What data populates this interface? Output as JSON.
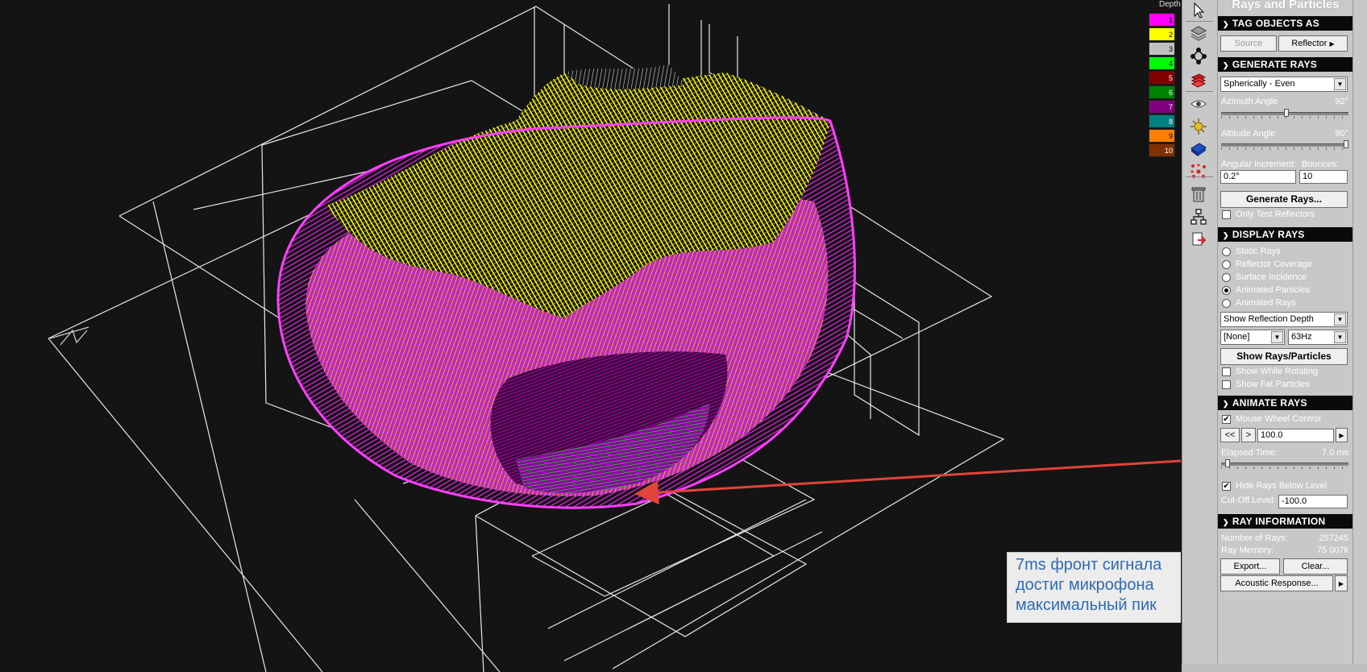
{
  "depth_legend": {
    "title": "Depth",
    "items": [
      {
        "label": "1",
        "color": "#ff00ff"
      },
      {
        "label": "2",
        "color": "#ffff00"
      },
      {
        "label": "3",
        "color": "#c0c0c0"
      },
      {
        "label": "4",
        "color": "#00ff00"
      },
      {
        "label": "5",
        "color": "#800000"
      },
      {
        "label": "6",
        "color": "#008000"
      },
      {
        "label": "7",
        "color": "#800080"
      },
      {
        "label": "8",
        "color": "#008080"
      },
      {
        "label": "9",
        "color": "#ff8000"
      },
      {
        "label": "10",
        "color": "#803000"
      }
    ]
  },
  "annotation": {
    "line1": "7ms фронт сигнала",
    "line2": "достиг микрофона",
    "line3": "максимальный пик"
  },
  "toolbar": {
    "tools": [
      "pointer-icon",
      "layers-icon",
      "nodes-icon",
      "materials-icon",
      "eye-icon",
      "light-icon",
      "surface-icon",
      "rays-icon",
      "trash-icon",
      "network-icon",
      "export-icon"
    ]
  },
  "panel": {
    "title": "Rays and Particles",
    "tag_objects": {
      "header": "TAG OBJECTS AS",
      "source_label": "Source",
      "reflector_label": "Reflector"
    },
    "generate_rays": {
      "header": "GENERATE RAYS",
      "distribution": "Spherically - Even",
      "azimuth_label": "Azimuth Angle",
      "azimuth_value": "92°",
      "azimuth_fraction": 0.51,
      "altitude_label": "Altitude Angle",
      "altitude_value": "90°",
      "altitude_fraction": 1.0,
      "increment_label": "Angular Increment:",
      "increment_value": "0.2°",
      "bounces_label": "Bounces:",
      "bounces_value": "10",
      "generate_button": "Generate Rays...",
      "only_test_label": "Only Test Reflectors"
    },
    "display_rays": {
      "header": "DISPLAY RAYS",
      "options": [
        "Static Rays",
        "Reflector Coverage",
        "Surface Incidence",
        "Animated Particles",
        "Animated Rays"
      ],
      "selected_option": "Animated Particles",
      "mode_select": "Show Reflection Depth",
      "filter_select": "[None]",
      "freq_select": "63Hz",
      "show_button": "Show Rays/Particles",
      "show_rotating_label": "Show While Rotating",
      "show_fat_label": "Show Fat Particles"
    },
    "animate_rays": {
      "header": "ANIMATE RAYS",
      "mouse_wheel_label": "Mouse Wheel Control",
      "back_label": "<<",
      "fwd_label": ">",
      "speed_value": "100.0",
      "elapsed_label": "Elapsed Time:",
      "elapsed_value": "7.0 ms",
      "elapsed_fraction": 0.03,
      "hide_below_label": "Hide Rays Below Level",
      "cutoff_label": "Cut-Off Level:",
      "cutoff_value": "-100.0"
    },
    "ray_information": {
      "header": "RAY INFORMATION",
      "num_rays_label": "Number of Rays:",
      "num_rays_value": "257245",
      "memory_label": "Ray Memory:",
      "memory_value": "75 007k",
      "export_label": "Export...",
      "clear_label": "Clear...",
      "acoustic_label": "Acoustic Response..."
    }
  }
}
